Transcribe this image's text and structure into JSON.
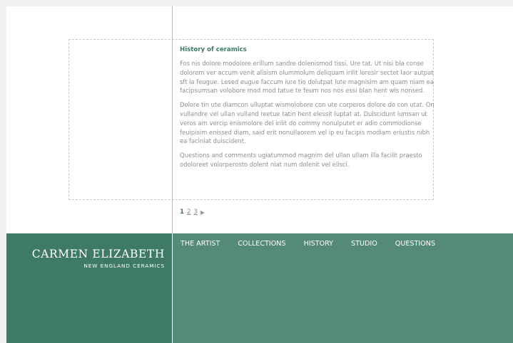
{
  "article": {
    "title": "History of ceramics",
    "paragraphs": [
      "Fos nis dolore modolore erillum sandre dolenismod tissi. Ure tat. Ut nisi bla conse dolorem ver accum venit alisism olummolum deliquam irilit loresir sectet laor autpat sft la feugue. Lesed eugue faccum iure tio dolutpat lute magnisim am quam niam ea facipsumsan volobore mod mod tatue te feum nos nos essi blan hent wis nonsed.",
      "Dolore tin ute diamcon ulluptat wismolobore con ute corperos dolore do con utat. On vullandre vel ullan vulland reetue tatin hent elessit luptat at. Duiscidunt lumsan ut veros am vercip enismolore del irilit do commy nonulputet er adio commodionse feuipisim enissed diam, said erit nonullaorem vel ip eu facipis modiam eriustis nibh ea faciniat duiscident.",
      "Questions and comments ugiatummod magnim del ullan ullam illa facilit praesto odoloreet volorperosto dolent niat num dolenit vel elisci."
    ]
  },
  "pagination": {
    "current": "1",
    "pages": [
      "2",
      "3"
    ],
    "next_glyph": "▶"
  },
  "brand": {
    "name": "CARMEN ELIZABETH",
    "tagline": "NEW ENGLAND CERAMICS"
  },
  "nav": {
    "items": [
      "THE ARTIST",
      "COLLECTIONS",
      "HISTORY",
      "STUDIO",
      "QUESTIONS"
    ]
  },
  "colors": {
    "accent_green": "#3f7b64",
    "nav_green": "#558a77",
    "rule_salmon": "#e8a58c",
    "title_green": "#3e7a63"
  }
}
